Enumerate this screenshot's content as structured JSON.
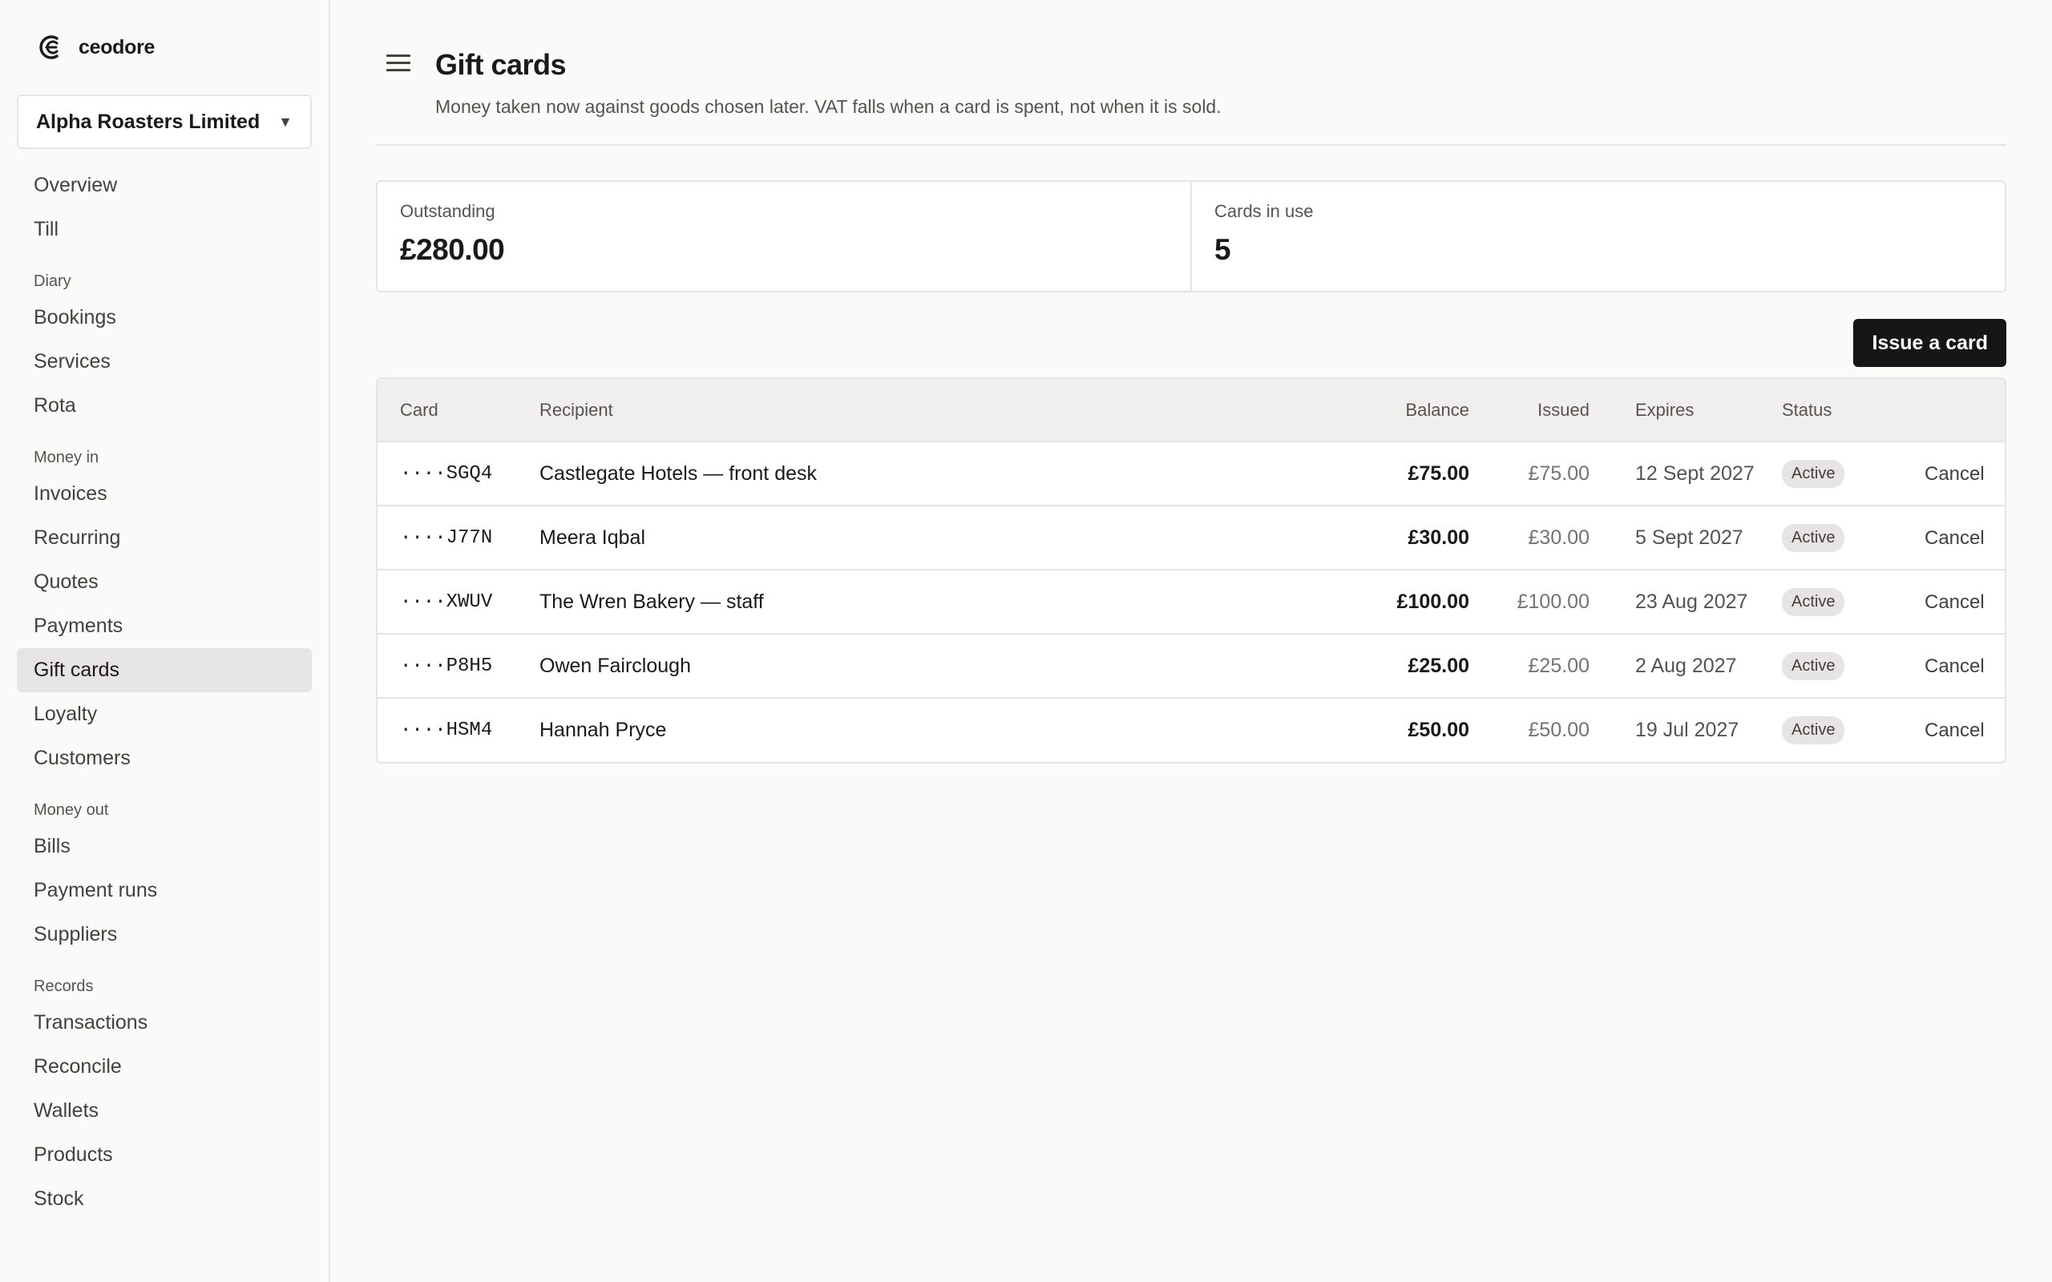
{
  "brand": {
    "name": "ceodore"
  },
  "org": {
    "name": "Alpha Roasters Limited"
  },
  "sidebar": {
    "top": [
      {
        "label": "Overview"
      },
      {
        "label": "Till"
      }
    ],
    "diary": {
      "title": "Diary",
      "items": [
        {
          "label": "Bookings"
        },
        {
          "label": "Services"
        },
        {
          "label": "Rota"
        }
      ]
    },
    "money_in": {
      "title": "Money in",
      "items": [
        {
          "label": "Invoices"
        },
        {
          "label": "Recurring"
        },
        {
          "label": "Quotes"
        },
        {
          "label": "Payments"
        },
        {
          "label": "Gift cards"
        },
        {
          "label": "Loyalty"
        },
        {
          "label": "Customers"
        }
      ]
    },
    "money_out": {
      "title": "Money out",
      "items": [
        {
          "label": "Bills"
        },
        {
          "label": "Payment runs"
        },
        {
          "label": "Suppliers"
        }
      ]
    },
    "records": {
      "title": "Records",
      "items": [
        {
          "label": "Transactions"
        },
        {
          "label": "Reconcile"
        },
        {
          "label": "Wallets"
        },
        {
          "label": "Products"
        },
        {
          "label": "Stock"
        }
      ]
    },
    "active": "Gift cards"
  },
  "page": {
    "title": "Gift cards",
    "subtitle": "Money taken now against goods chosen later. VAT falls when a card is spent, not when it is sold."
  },
  "stats": {
    "outstanding": {
      "label": "Outstanding",
      "value": "£280.00"
    },
    "cards_in_use": {
      "label": "Cards in use",
      "value": "5"
    }
  },
  "actions": {
    "issue_label": "Issue a card"
  },
  "table": {
    "columns": {
      "card": "Card",
      "recipient": "Recipient",
      "balance": "Balance",
      "issued": "Issued",
      "expires": "Expires",
      "status": "Status"
    },
    "rows": [
      {
        "card": "····SGQ4",
        "recipient": "Castlegate Hotels — front desk",
        "balance": "£75.00",
        "issued": "£75.00",
        "expires": "12 Sept 2027",
        "status": "Active",
        "action": "Cancel"
      },
      {
        "card": "····J77N",
        "recipient": "Meera Iqbal",
        "balance": "£30.00",
        "issued": "£30.00",
        "expires": "5 Sept 2027",
        "status": "Active",
        "action": "Cancel"
      },
      {
        "card": "····XWUV",
        "recipient": "The Wren Bakery — staff",
        "balance": "£100.00",
        "issued": "£100.00",
        "expires": "23 Aug 2027",
        "status": "Active",
        "action": "Cancel"
      },
      {
        "card": "····P8H5",
        "recipient": "Owen Fairclough",
        "balance": "£25.00",
        "issued": "£25.00",
        "expires": "2 Aug 2027",
        "status": "Active",
        "action": "Cancel"
      },
      {
        "card": "····HSM4",
        "recipient": "Hannah Pryce",
        "balance": "£50.00",
        "issued": "£50.00",
        "expires": "19 Jul 2027",
        "status": "Active",
        "action": "Cancel"
      }
    ]
  },
  "colors": {
    "background": "#fafaf9",
    "primary_button": "#161616",
    "active_nav": "#e7e5e4",
    "badge_bg": "#e7e5e4"
  }
}
